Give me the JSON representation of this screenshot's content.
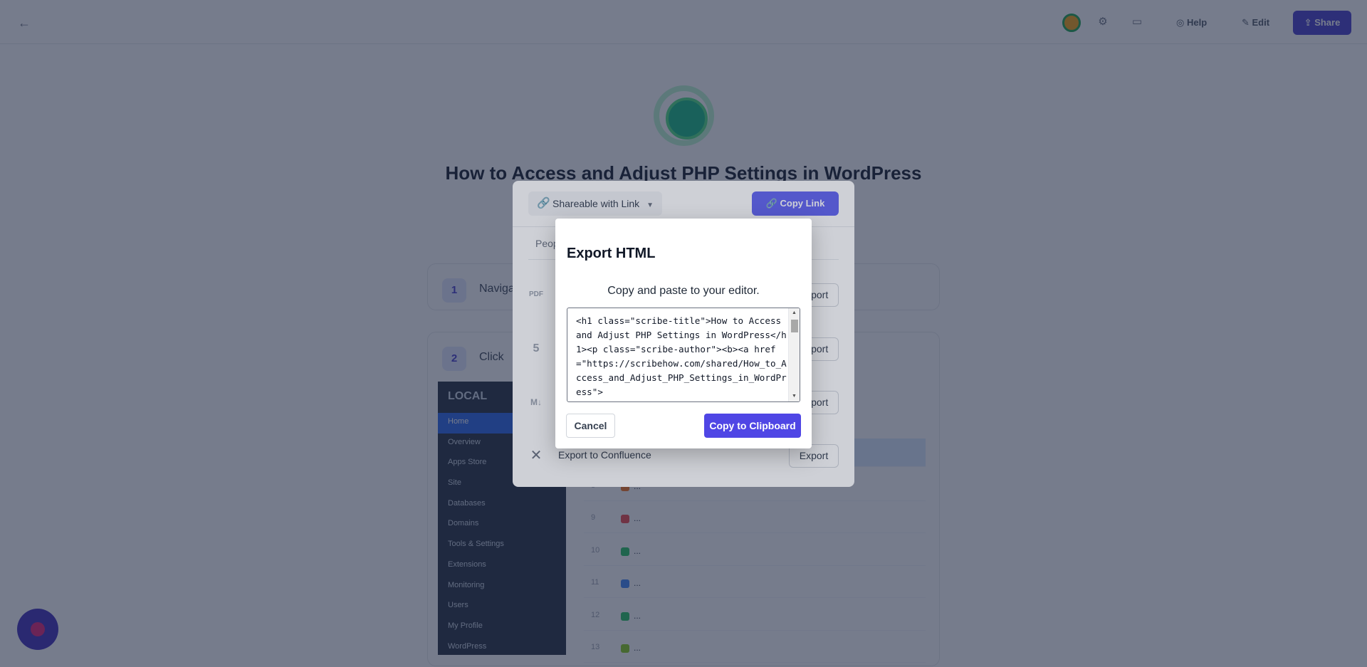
{
  "topbar": {
    "help_label": "Help",
    "edit_label": "Edit",
    "share_label": "Share"
  },
  "guide": {
    "title": "How to Access and Adjust PHP Settings in WordPress",
    "steps": [
      {
        "number": "1",
        "text": "Navigate"
      },
      {
        "number": "2",
        "text": "Click"
      }
    ]
  },
  "wp_sidebar": {
    "header": "LOCAL",
    "items": [
      "Home",
      "Overview",
      "Apps Store",
      "Site",
      "Databases",
      "Domains",
      "Tools & Settings",
      "Extensions",
      "Monitoring",
      "Users",
      "My Profile",
      "WordPress"
    ]
  },
  "file_rows": [
    {
      "num": "8",
      "name": "...",
      "color": "#f97316"
    },
    {
      "num": "9",
      "name": "...",
      "color": "#ef4444"
    },
    {
      "num": "10",
      "name": "...",
      "color": "#22c55e"
    },
    {
      "num": "11",
      "name": "...",
      "color": "#3b82f6"
    },
    {
      "num": "12",
      "name": "...",
      "color": "#22c55e"
    },
    {
      "num": "13",
      "name": "...",
      "color": "#84cc16"
    }
  ],
  "share_panel": {
    "visibility": "Shareable with Link",
    "copy_link": "Copy Link",
    "people_tab": "Peop",
    "exports": [
      {
        "icon": "PDF",
        "label": "",
        "button": "Export"
      },
      {
        "icon": "5",
        "label": "",
        "button": "Export"
      },
      {
        "icon": "M↓",
        "label": "",
        "button": "Export"
      },
      {
        "icon": "✕",
        "label": "Export to Confluence",
        "button": "Export"
      }
    ]
  },
  "modal": {
    "title": "Export HTML",
    "subtitle": "Copy and paste to your editor.",
    "code": "<h1 class=\"scribe-title\">How to Access and Adjust PHP Settings in WordPress</h1><p class=\"scribe-author\"><b><a href=\"https://scribehow.com/shared/How_to_Access_and_Adjust_PHP_Settings_in_WordPress\">",
    "cancel": "Cancel",
    "copy": "Copy to Clipboard"
  },
  "colors": {
    "primary": "#4f46e5",
    "copy_link_bg": "#6366f1"
  }
}
